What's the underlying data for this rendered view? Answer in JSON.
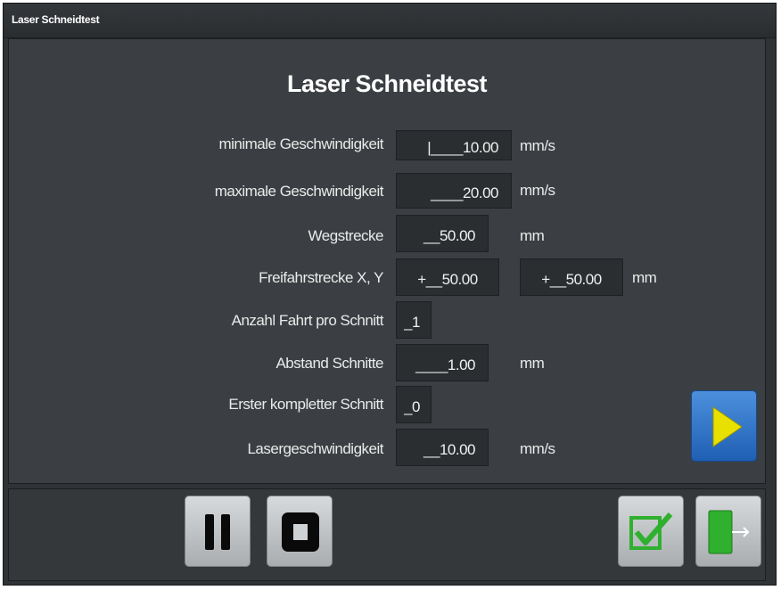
{
  "window": {
    "title": "Laser Schneidtest"
  },
  "form": {
    "heading": "Laser Schneidtest",
    "fields": [
      {
        "label": "minimale Geschwindigkeit",
        "value": "|____10.00",
        "unit": "mm/s"
      },
      {
        "label": "maximale Geschwindigkeit",
        "value": "____20.00",
        "unit": "mm/s"
      },
      {
        "label": "Wegstrecke",
        "value": "__50.00",
        "unit": "mm"
      },
      {
        "label": "Freifahrstrecke X, Y",
        "value_x": "+__50.00",
        "value_y": "+__50.00",
        "unit": "mm"
      },
      {
        "label": "Anzahl Fahrt pro Schnitt",
        "value": "_1"
      },
      {
        "label": "Abstand Schnitte",
        "value": "____1.00",
        "unit": "mm"
      },
      {
        "label": "Erster kompletter Schnitt",
        "value": "_0"
      },
      {
        "label": "Lasergeschwindigkeit",
        "value": "__10.00",
        "unit": "mm/s"
      }
    ]
  },
  "icons": {
    "play": "play-icon",
    "pause": "pause-icon",
    "stop": "stop-icon",
    "confirm": "checkmark-icon",
    "exit": "exit-door-icon"
  },
  "colors": {
    "play_bg": "#2f74c8",
    "play_arrow": "#e8e000",
    "confirm_check": "#2fb02f",
    "exit_door": "#2fb02f"
  }
}
